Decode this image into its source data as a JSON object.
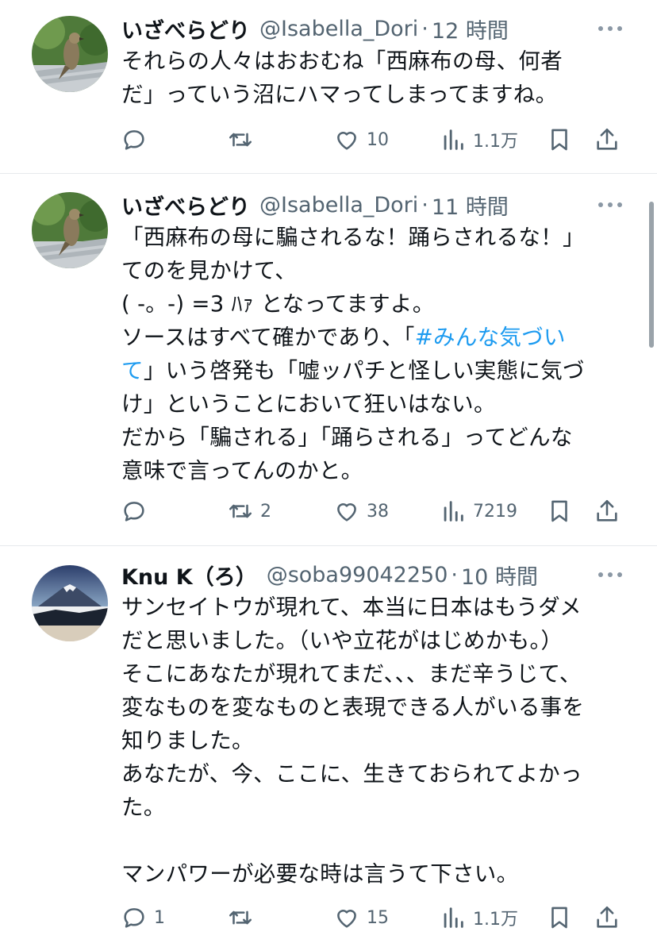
{
  "tweets": [
    {
      "name": "いざべらどり",
      "handle": "@Isabella_Dori",
      "dot": "·",
      "time": "12 時間",
      "avatar_icon": "hawk-avatar-icon",
      "lines": [
        "それらの人々はおおむね「西麻布の母、何者",
        "だ」っていう沼にハマってしまってますね。"
      ],
      "reply_count": "",
      "retweet_count": "",
      "like_count": "10",
      "view_count": "1.1万"
    },
    {
      "name": "いざべらどり",
      "handle": "@Isabella_Dori",
      "dot": "·",
      "time": "11 時間",
      "avatar_icon": "hawk-avatar-icon",
      "lines": [
        "「西麻布の母に騙されるな！踊らされるな！」",
        "てのを見かけて、",
        "( -。-) =3 ﾊｧ となってますよ。",
        "ソースはすべて確かであり、「",
        "て」いう啓発も「嘘ッパチと怪しい実態に気づ",
        "け」ということにおいて狂いはない。",
        "だから「騙される」「踊らされる」ってどんな",
        "意味で言ってんのかと。"
      ],
      "hashtag": "#みんな気づい",
      "reply_count": "",
      "retweet_count": "2",
      "like_count": "38",
      "view_count": "7219"
    },
    {
      "name": "Knu K（ろ）",
      "handle": "@soba99042250",
      "dot": "·",
      "time": "10 時間",
      "avatar_icon": "mountain-fuji-avatar-icon",
      "lines": [
        "サンセイトウが現れて、本当に日本はもうダメ",
        "だと思いました。（いや立花がはじめかも。）",
        "そこにあなたが現れてまだ、、、まだ辛うじて、",
        "変なものを変なものと表現できる人がいる事を",
        "知りました。",
        "あなたが、今、ここに、生きておられてよかっ",
        "た。",
        "",
        "マンパワーが必要な時は言うて下さい。"
      ],
      "reply_count": "1",
      "retweet_count": "",
      "like_count": "15",
      "view_count": "1.1万"
    }
  ],
  "colors": {
    "text": "#0f1419",
    "secondary": "#536471",
    "link": "#1d9bf0",
    "divider": "#e6e9ec"
  }
}
